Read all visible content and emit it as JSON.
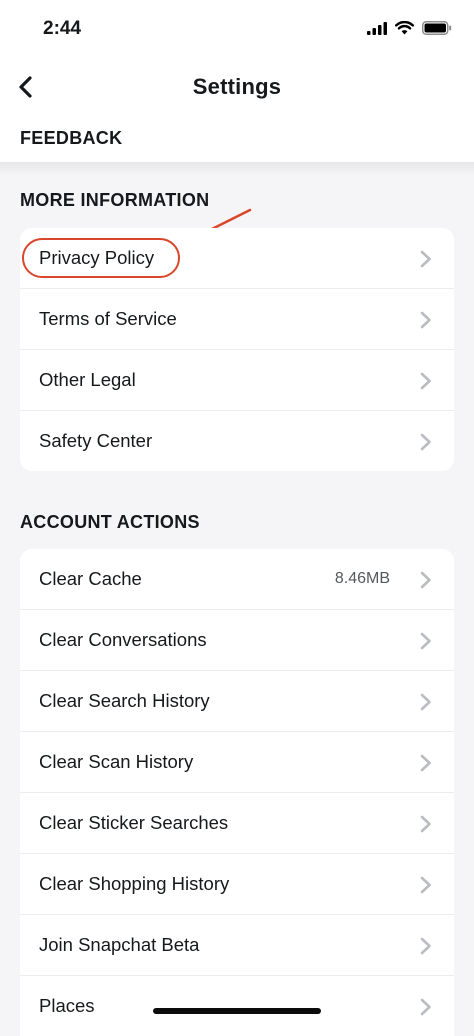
{
  "status_bar": {
    "time": "2:44",
    "icons": [
      "cellular-signal-icon",
      "wifi-icon",
      "battery-icon"
    ]
  },
  "nav": {
    "title": "Settings",
    "back_icon": "chevron-left-icon"
  },
  "sections": {
    "feedback": {
      "title": "FEEDBACK"
    },
    "more_information": {
      "title": "MORE INFORMATION",
      "items": [
        {
          "label": "Privacy Policy",
          "highlighted": true
        },
        {
          "label": "Terms of Service"
        },
        {
          "label": "Other Legal"
        },
        {
          "label": "Safety Center"
        }
      ]
    },
    "account_actions": {
      "title": "ACCOUNT ACTIONS",
      "items": [
        {
          "label": "Clear Cache",
          "value": "8.46MB"
        },
        {
          "label": "Clear Conversations"
        },
        {
          "label": "Clear Search History"
        },
        {
          "label": "Clear Scan History"
        },
        {
          "label": "Clear Sticker Searches"
        },
        {
          "label": "Clear Shopping History"
        },
        {
          "label": "Join Snapchat Beta"
        },
        {
          "label": "Places"
        }
      ]
    }
  },
  "colors": {
    "annotation": "#d9462b",
    "background": "#f5f5f7",
    "chevron": "#b9bcc0"
  }
}
